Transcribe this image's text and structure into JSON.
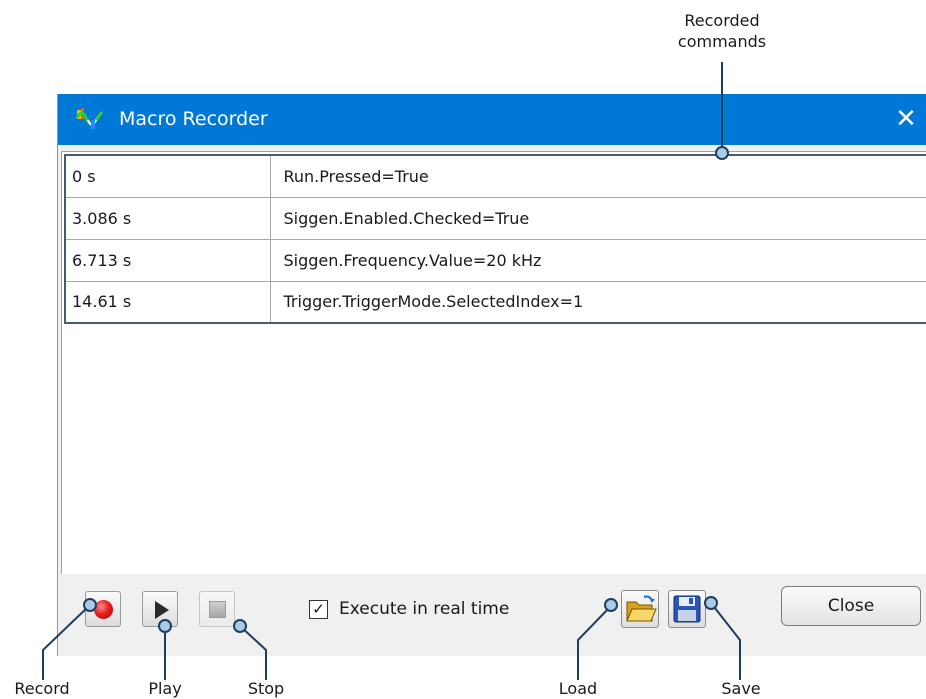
{
  "window": {
    "title": "Macro Recorder",
    "close_glyph": "✕"
  },
  "commands": [
    {
      "time": "0 s",
      "command": "Run.Pressed=True"
    },
    {
      "time": "3.086 s",
      "command": "Siggen.Enabled.Checked=True"
    },
    {
      "time": "6.713 s",
      "command": "Siggen.Frequency.Value=20 kHz"
    },
    {
      "time": "14.61 s",
      "command": "Trigger.TriggerMode.SelectedIndex=1"
    }
  ],
  "toolbar": {
    "execute_realtime_label": "Execute in real time",
    "execute_realtime_checked": true,
    "check_glyph": "✓",
    "close_label": "Close",
    "icons": {
      "record": "record-icon",
      "play": "play-icon",
      "stop": "stop-icon",
      "load": "folder-open-icon",
      "save": "floppy-disk-icon"
    }
  },
  "callouts": {
    "recorded_line1": "Recorded",
    "recorded_line2": "commands",
    "record": "Record",
    "play": "Play",
    "stop": "Stop",
    "load": "Load",
    "save": "Save"
  },
  "colors": {
    "titlebar": "#0078d7",
    "callout_line": "#1f3d5c",
    "record_red": "#e52020"
  }
}
